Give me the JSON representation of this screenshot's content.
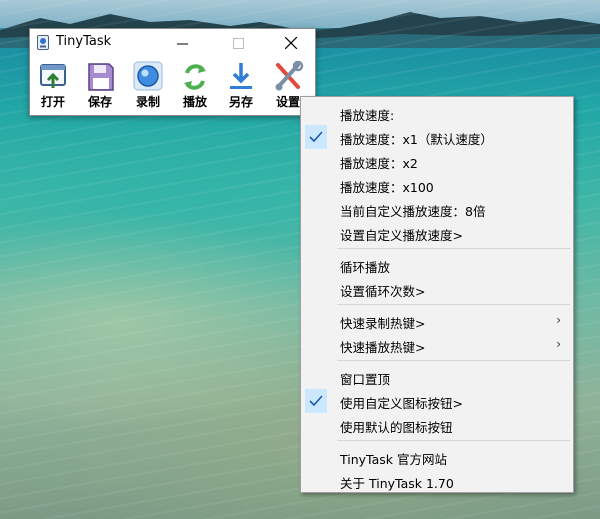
{
  "window": {
    "title": "TinyTask",
    "controls": [
      "minimize",
      "maximize",
      "close"
    ]
  },
  "toolbar": {
    "buttons": [
      {
        "label": "打开",
        "icon": "open-icon"
      },
      {
        "label": "保存",
        "icon": "save-icon"
      },
      {
        "label": "录制",
        "icon": "record-icon"
      },
      {
        "label": "播放",
        "icon": "play-icon"
      },
      {
        "label": "另存",
        "icon": "save-as-icon"
      },
      {
        "label": "设置",
        "icon": "settings-icon"
      }
    ]
  },
  "menu": {
    "items": [
      {
        "label": "播放速度:"
      },
      {
        "label": "播放速度：x1（默认速度）",
        "checked": true
      },
      {
        "label": "播放速度：x2"
      },
      {
        "label": "播放速度：x100"
      },
      {
        "label": "当前自定义播放速度：8倍"
      },
      {
        "label": "设置自定义播放速度>"
      },
      {
        "label": "循环播放"
      },
      {
        "label": "设置循环次数>"
      },
      {
        "label": "快速录制热键>",
        "submenu": true
      },
      {
        "label": "快速播放热键>",
        "submenu": true
      },
      {
        "label": "窗口置顶"
      },
      {
        "label": "使用自定义图标按钮>",
        "checked": true
      },
      {
        "label": "使用默认的图标按钮"
      },
      {
        "label": "TinyTask 官方网站"
      },
      {
        "label": "关于 TinyTask 1.70"
      }
    ],
    "submenu_arrow": "›",
    "check_color": "#1a5aa8",
    "highlight_color": "#cce8ff"
  }
}
